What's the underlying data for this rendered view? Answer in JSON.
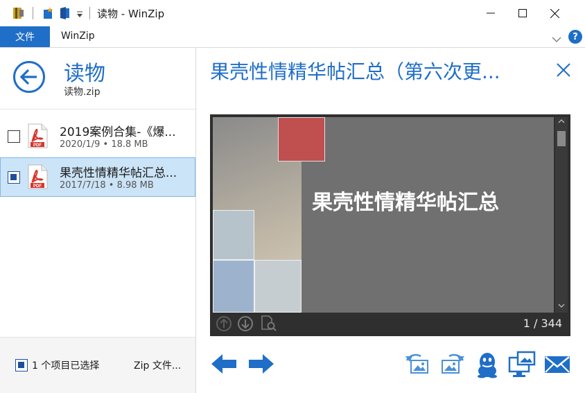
{
  "window": {
    "title": "读物 - WinZip",
    "minimize_label": "—",
    "maximize_label": "☐",
    "close_label": "✕"
  },
  "ribbon": {
    "file_tab": "文件",
    "winzip_tab": "WinZip",
    "help_label": "?",
    "collapse_icon": "chevron-down-icon"
  },
  "archive": {
    "name": "读物",
    "filename": "读物.zip"
  },
  "files": [
    {
      "name": "2019案例合集-《爆...",
      "date": "2020/1/9",
      "size": "18.8 MB",
      "checked": false,
      "selected": false,
      "meta": "2020/1/9 • 18.8 MB"
    },
    {
      "name": "果壳性情精华帖汇总...",
      "date": "2017/7/18",
      "size": "8.98 MB",
      "checked": true,
      "selected": true,
      "meta": "2017/7/18 • 8.98 MB"
    }
  ],
  "footer": {
    "selection_label": "1 个项目已选择",
    "zip_link": "Zip 文件..."
  },
  "preview": {
    "title": "果壳性情精华帖汇总（第六次更...",
    "slide_title": "果壳性情精华帖汇总",
    "page_counter": "1 / 344",
    "pdf_badge": "PDF"
  },
  "colors": {
    "accent": "#1f6ec7",
    "selected_row": "#cce4f7",
    "slide_bg": "#707070",
    "slide_red": "#c04f50"
  }
}
